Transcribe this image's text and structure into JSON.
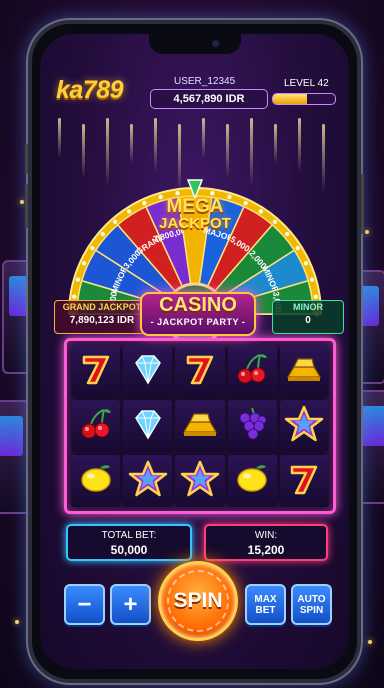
{
  "header": {
    "logo": "ka789",
    "username": "USER_12345",
    "balance": "4,567,890 IDR",
    "level_label": "LEVEL 42",
    "level_progress": 0.55
  },
  "wheel": {
    "title_line1": "MEGA",
    "title_line2": "JACKPOT",
    "segments": [
      {
        "label": "1,000",
        "color": "#1a8a3a"
      },
      {
        "label": "MINOR",
        "color": "#1c56d4"
      },
      {
        "label": "3,000",
        "color": "#1c56d4"
      },
      {
        "label": "GRAND",
        "color": "#d02020"
      },
      {
        "label": "7,800,000",
        "color": "#7a2cd0"
      },
      {
        "label": "MEGA",
        "color": "#f2b400"
      },
      {
        "label": "MAJOR",
        "color": "#1a62e0"
      },
      {
        "label": "5,000",
        "color": "#d02020"
      },
      {
        "label": "2,000",
        "color": "#1a8a3a"
      },
      {
        "label": "MINOR",
        "color": "#1c8acc"
      },
      {
        "label": "3,000",
        "color": "#1a8a3a"
      }
    ]
  },
  "banner": {
    "title": "CASINO",
    "subtitle": "- JACKPOT PARTY -"
  },
  "grand_jackpot": {
    "label": "GRAND JACKPOT",
    "value": "7,890,123 IDR"
  },
  "minor_jackpot": {
    "label": "MINOR",
    "value": "0"
  },
  "reels": [
    [
      "seven",
      "diamond",
      "seven",
      "cherry",
      "gold"
    ],
    [
      "cherry",
      "diamond",
      "gold",
      "grape",
      "star"
    ],
    [
      "lemon",
      "star",
      "star",
      "lemon",
      "seven"
    ]
  ],
  "bet": {
    "label": "TOTAL BET:",
    "value": "50,000"
  },
  "win": {
    "label": "WIN:",
    "value": "15,200"
  },
  "controls": {
    "minus": "−",
    "plus": "+",
    "spin": "SPIN",
    "max_bet_1": "MAX",
    "max_bet_2": "BET",
    "auto_spin_1": "AUTO",
    "auto_spin_2": "SPIN"
  },
  "colors": {
    "accent": "#ff5ad8",
    "gold": "#ffcf3a",
    "bet_border": "#35c4ff",
    "win_border": "#ff3b7a",
    "spin": "#ff6a00"
  }
}
